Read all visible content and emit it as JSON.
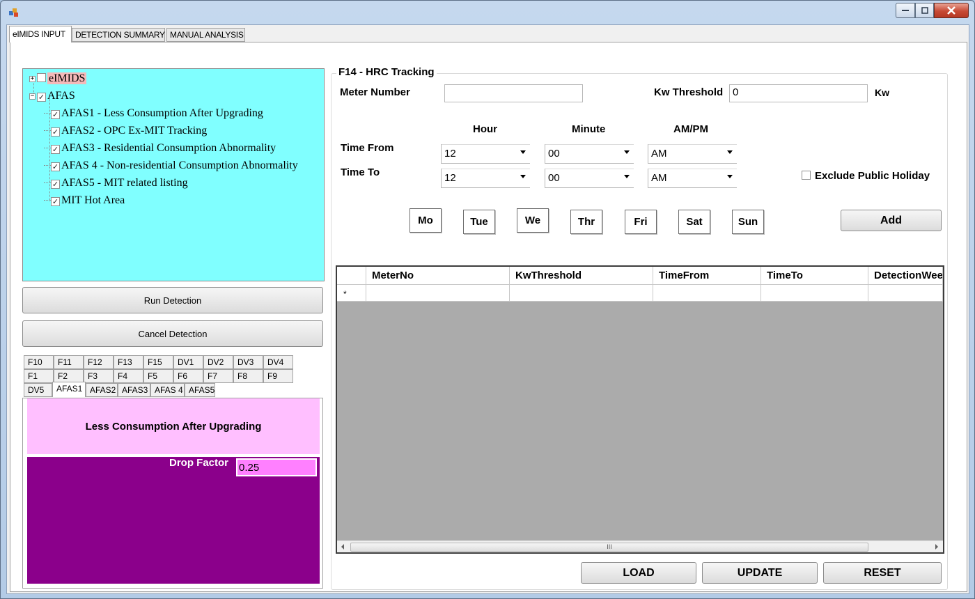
{
  "window": {
    "title": ""
  },
  "main_tabs": [
    {
      "label": "eIMIDS INPUT"
    },
    {
      "label": "DETECTION SUMMARY"
    },
    {
      "label": "MANUAL ANALYSIS"
    }
  ],
  "tree": {
    "root1": {
      "label": "eIMIDS",
      "checked": false,
      "expanded": false
    },
    "root2": {
      "label": "AFAS",
      "checked": true,
      "expanded": true
    },
    "children": [
      {
        "label": "AFAS1 - Less Consumption After Upgrading"
      },
      {
        "label": "AFAS2 - OPC Ex-MIT Tracking"
      },
      {
        "label": "AFAS3 - Residential Consumption Abnormality"
      },
      {
        "label": "AFAS 4 - Non-residential Consumption Abnormality"
      },
      {
        "label": "AFAS5 - MIT related listing"
      },
      {
        "label": "MIT Hot Area"
      }
    ],
    "check_glyph": "✓"
  },
  "buttons": {
    "run_detection": "Run Detection",
    "cancel_detection": "Cancel Detection",
    "add": "Add",
    "load": "LOAD",
    "update": "UPDATE",
    "reset": "RESET"
  },
  "small_tabs": {
    "row1": [
      "F10",
      "F11",
      "F12",
      "F13",
      "F15",
      "DV1",
      "DV2",
      "DV3",
      "DV4"
    ],
    "row2": [
      "F1",
      "F2",
      "F3",
      "F4",
      "F5",
      "F6",
      "F7",
      "F8",
      "F9"
    ],
    "row3": [
      "DV5",
      "AFAS1",
      "AFAS2",
      "AFAS3",
      "AFAS 4",
      "AFAS5"
    ],
    "active": "AFAS1"
  },
  "afas_panel": {
    "header": "Less Consumption After Upgrading",
    "drop_factor_label": "Drop Factor",
    "drop_factor_value": "0.25"
  },
  "hrc": {
    "group_title": "F14 - HRC Tracking",
    "meter_number_label": "Meter Number",
    "meter_number_value": "",
    "kw_threshold_label": "Kw Threshold",
    "kw_threshold_value": "0",
    "kw_unit": "Kw",
    "col_hour": "Hour",
    "col_minute": "Minute",
    "col_ampm": "AM/PM",
    "time_from_label": "Time From",
    "time_to_label": "Time To",
    "from_hour": "12",
    "from_minute": "00",
    "from_ampm": "AM",
    "to_hour": "12",
    "to_minute": "00",
    "to_ampm": "AM",
    "exclude_holiday_label": "Exclude Public Holiday",
    "days": [
      "Mo",
      "Tue",
      "We",
      "Thr",
      "Fri",
      "Sat",
      "Sun"
    ]
  },
  "grid": {
    "columns": [
      "MeterNo",
      "KwThreshold",
      "TimeFrom",
      "TimeTo",
      "DetectionWee"
    ],
    "new_row_marker": "*",
    "scroll_grip": "III"
  },
  "colors": {
    "tree_bg": "#80ffff",
    "afas_header_bg": "#ffbfff",
    "afas_body_bg": "#8b008b",
    "drop_input_bg": "#ff80ff"
  }
}
